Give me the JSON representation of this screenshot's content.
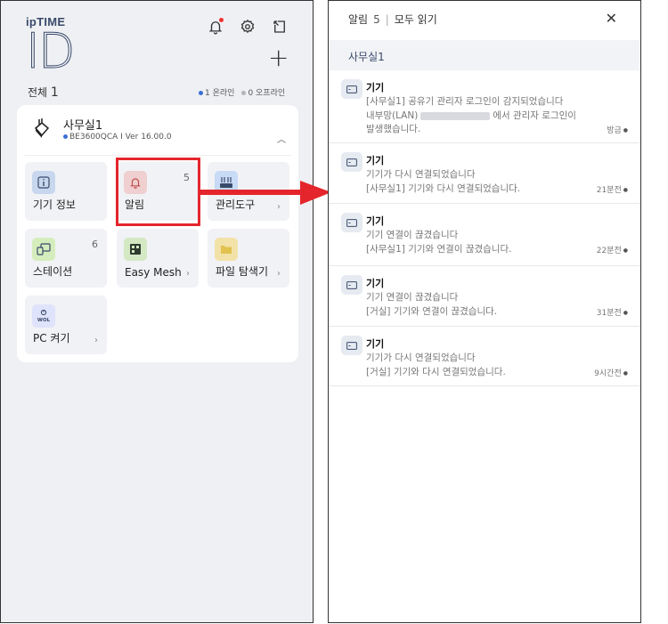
{
  "left": {
    "logo_small": "ipTIME",
    "logo_big": "ID",
    "total_label": "전체",
    "total_count": "1",
    "online_label": "1 온라인",
    "offline_label": "0 오프라인",
    "device": {
      "name": "사무실1",
      "model": "BE3600QCA I Ver 16.00.0"
    },
    "tiles": {
      "info": "기기 정보",
      "alarm": "알림",
      "alarm_count": "5",
      "manage": "관리도구",
      "station": "스테이션",
      "station_count": "6",
      "mesh": "Easy Mesh",
      "files": "파일 탐색기",
      "pc": "PC 켜기"
    },
    "colors": {
      "online": "#3b6fd8",
      "offline": "#b5b5b5",
      "highlight": "#e4262c"
    }
  },
  "right": {
    "title": "알림",
    "count": "5",
    "sep": "|",
    "read_all": "모두 읽기",
    "group": "사무실1",
    "notifications": [
      {
        "title": "기기",
        "l1": "[사무실1] 공유기 관리자 로그인이 감지되었습니다",
        "l2a": "내부망(LAN)",
        "l2b": "에서 관리자 로그인이",
        "l3": "발생했습니다.",
        "time": "방금"
      },
      {
        "title": "기기",
        "l1": "기기가 다시 연결되었습니다",
        "l2": "[사무실1] 기기와 다시 연결되었습니다.",
        "time": "21분전"
      },
      {
        "title": "기기",
        "l1": "기기 연결이 끊겼습니다",
        "l2": "[사무실1] 기기와 연결이 끊겼습니다.",
        "time": "22분전"
      },
      {
        "title": "기기",
        "l1": "기기 연결이 끊겼습니다",
        "l2": "[거실] 기기와 연결이 끊겼습니다.",
        "time": "31분전"
      },
      {
        "title": "기기",
        "l1": "기기가 다시 연결되었습니다",
        "l2": "[거실] 기기와 다시 연결되었습니다.",
        "time": "9시간전"
      }
    ]
  }
}
